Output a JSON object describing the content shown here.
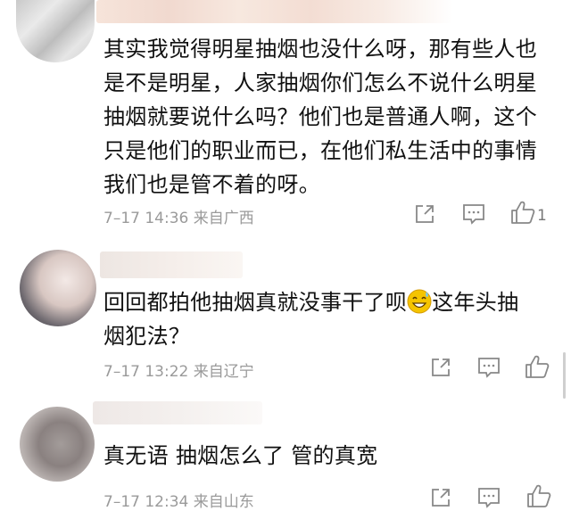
{
  "comments": [
    {
      "text_lines": [
        "其实我觉得明星抽烟也没什么呀，那有些人也",
        "是不是明星，人家抽烟你们怎么不说什么明星",
        "抽烟就要说什么吗？他们也是普通人啊，这个",
        "只是他们的职业而已，在他们私生活中的事情",
        "我们也是管不着的呀。"
      ],
      "meta": "7–17 14:36  来自广西",
      "like_count": "1",
      "icons": [
        "share-icon",
        "comment-icon",
        "like-icon"
      ]
    },
    {
      "text_line1_before": "回回都拍他抽烟真就没事干了呗",
      "text_line1_after": "这年头抽",
      "text_line2": "烟犯法？",
      "emoji": "sweat-smile-emoji",
      "meta": "7–17 13:22  来自辽宁",
      "icons": [
        "share-icon",
        "comment-icon",
        "like-icon"
      ]
    },
    {
      "text_lines": [
        "真无语  抽烟怎么了  管的真宽"
      ],
      "meta": "7–17 12:34  来自山东",
      "icons": [
        "share-icon",
        "comment-icon",
        "like-icon"
      ]
    }
  ],
  "colors": {
    "text": "#111111",
    "meta": "#9a9a9a",
    "icon": "#888888",
    "emoji_face": "#f5c400"
  }
}
